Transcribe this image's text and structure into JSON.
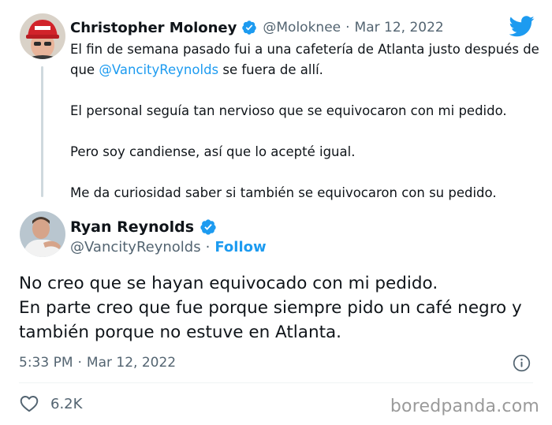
{
  "parent_tweet": {
    "display_name": "Christopher Moloney",
    "handle": "@Moloknee",
    "separator": "·",
    "date": "Mar 12, 2022",
    "lines": [
      {
        "before": "El fin de semana pasado fui a una cafetería de Atlanta justo después de que ",
        "mention": "@VancityReynolds",
        "after": " se fuera de allí."
      },
      {
        "text": "El personal seguía tan nervioso que se equivocaron con mi pedido."
      },
      {
        "text": "Pero soy candiense, así que lo acepté igual."
      },
      {
        "text": "Me da curiosidad saber si también se equivocaron con su pedido."
      }
    ],
    "verified_icon": "verified-badge-icon",
    "avatar": "avatar-red-cap"
  },
  "reply_tweet": {
    "display_name": "Ryan Reynolds",
    "handle": "@VancityReynolds",
    "separator": "·",
    "follow_label": "Follow",
    "text_lines": [
      "No creo que se hayan equivocado con mi pedido.",
      "En parte creo que fue porque siempre pido un café negro y también porque no estuve en Atlanta."
    ],
    "time": "5:33 PM",
    "date_separator": "·",
    "date": "Mar 12, 2022",
    "likes": "6.2K",
    "verified_icon": "verified-badge-icon",
    "info_icon": "info-icon",
    "like_icon": "heart-icon"
  },
  "brand": {
    "logo_icon": "twitter-bird-icon",
    "watermark": "boredpanda.com"
  },
  "colors": {
    "accent": "#1d9bf0",
    "text": "#0f1419",
    "muted": "#536471",
    "thread_line": "#cfd9de"
  }
}
